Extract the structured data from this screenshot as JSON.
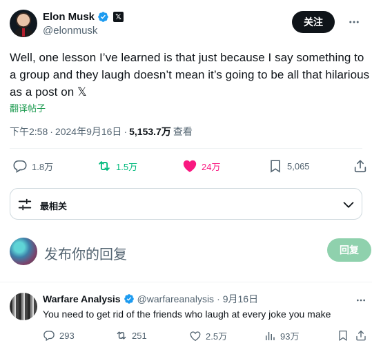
{
  "author": {
    "display_name": "Elon Musk",
    "handle": "@elonmusk",
    "verified": true,
    "affiliate_badge": "𝕏",
    "follow_label": "关注"
  },
  "tweet": {
    "text": "Well, one lesson I’ve learned is that just because I say something to a group and they laugh doesn’t mean it’s going to be all that hilarious as a post on 𝕏",
    "translate_label": "翻译帖子",
    "time": "下午2:58",
    "sep1": "·",
    "date": "2024年9月16日",
    "sep2": "·",
    "views": "5,153.7万",
    "views_label": "查看"
  },
  "actions": {
    "replies": "1.8万",
    "reposts": "1.5万",
    "likes": "24万",
    "bookmarks": "5,065"
  },
  "sort": {
    "label": "最相关"
  },
  "composer": {
    "placeholder": "发布你的回复",
    "reply_label": "回复"
  },
  "replies": [
    {
      "display_name": "Warfare Analysis",
      "handle": "@warfareanalysis",
      "sep": "·",
      "date": "9月16日",
      "text": "You need to get rid of the friends who laugh at every joke you make",
      "replies": "293",
      "reposts": "251",
      "likes": "2.5万",
      "views": "93万"
    }
  ],
  "colors": {
    "accent_green": "#00ba7c",
    "like_pink": "#f91880",
    "verified_blue": "#1d9bf0",
    "reply_button_disabled": "#8fd1ad",
    "translate_green": "#1d9b50"
  },
  "icons": [
    "verified-badge-icon",
    "more-icon",
    "reply-icon",
    "repost-icon",
    "heart-icon",
    "bookmark-icon",
    "share-icon",
    "sliders-icon",
    "chevron-down-icon",
    "views-icon"
  ]
}
